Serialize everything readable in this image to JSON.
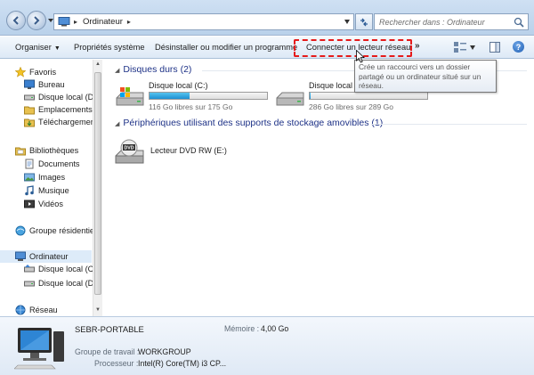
{
  "address": {
    "location": "Ordinateur",
    "separator": "▸"
  },
  "search": {
    "placeholder": "Rechercher dans : Ordinateur"
  },
  "toolbar": {
    "organize_label": "Organiser",
    "system_properties_label": "Propriétés système",
    "uninstall_label": "Désinstaller ou modifier un programme",
    "map_drive_label": "Connecter un lecteur réseau",
    "more_label": "»",
    "help_label": "?"
  },
  "sidebar": {
    "favorites": {
      "label": "Favoris",
      "items": [
        {
          "label": "Bureau",
          "icon": "desktop-icon"
        },
        {
          "label": "Disque local (D)",
          "icon": "drive-icon"
        },
        {
          "label": "Emplacements ré",
          "icon": "recent-places-icon"
        },
        {
          "label": "Téléchargements",
          "icon": "downloads-icon"
        }
      ]
    },
    "libraries": {
      "label": "Bibliothèques",
      "items": [
        {
          "label": "Documents",
          "icon": "documents-icon"
        },
        {
          "label": "Images",
          "icon": "pictures-icon"
        },
        {
          "label": "Musique",
          "icon": "music-icon"
        },
        {
          "label": "Vidéos",
          "icon": "videos-icon"
        }
      ]
    },
    "homegroup": {
      "label": "Groupe résidentiel"
    },
    "computer": {
      "label": "Ordinateur",
      "items": [
        {
          "label": "Disque local (C:)",
          "icon": "drive-icon"
        },
        {
          "label": "Disque local (D:)",
          "icon": "drive-icon"
        }
      ]
    },
    "network": {
      "label": "Réseau"
    }
  },
  "main": {
    "hard_drives_title": "Disques durs (2)",
    "drives": [
      {
        "name": "Disque local (C:)",
        "free": "116 Go libres sur 175 Go",
        "used_fraction": 0.34
      },
      {
        "name": "Disque local (D:)",
        "free": "286 Go libres sur 289 Go",
        "used_fraction": 0.01
      }
    ],
    "removable_title": "Périphériques utilisant des supports de stockage amovibles (1)",
    "removable": [
      {
        "name": "Lecteur DVD RW (E:)",
        "badge": "DVD"
      }
    ]
  },
  "tooltip": {
    "text": "Crée un raccourci vers un dossier partagé ou un ordinateur situé sur un réseau."
  },
  "details": {
    "computer_name": "SEBR-PORTABLE",
    "memory_label": "Mémoire :",
    "memory_value": "4,00 Go",
    "workgroup_label": "Groupe de travail :",
    "workgroup_value": "WORKGROUP",
    "processor_label": "Processeur :",
    "processor_value": "Intel(R) Core(TM) i3 CP..."
  },
  "colors": {
    "accent": "#1e3287",
    "highlight": "#e51b1b",
    "drive_fill": "#1e90d3"
  }
}
